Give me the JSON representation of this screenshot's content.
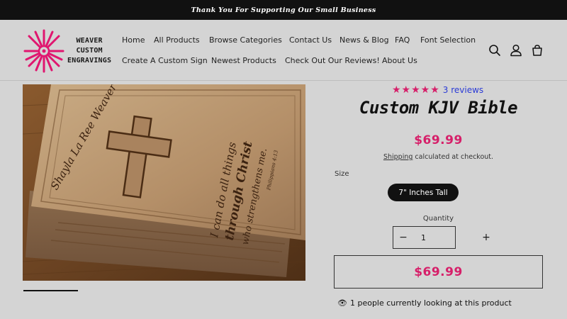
{
  "announcement": "Thank You For Supporting Our Small Business",
  "logo": {
    "line1": "WEAVER",
    "line2": "CUSTOM",
    "line3": "ENGRAVINGS",
    "brand_color": "#e0166f"
  },
  "nav": {
    "row1": [
      "Home",
      "All Products",
      "Browse Categories",
      "Contact Us",
      "News & Blog",
      "FAQ",
      "Font Selection"
    ],
    "row2": [
      "Create A Custom Sign",
      "Newest Products",
      "Check Out Our Reviews!",
      "About Us"
    ]
  },
  "header_icons": [
    "search-icon",
    "account-icon",
    "cart-icon"
  ],
  "product": {
    "rating_stars": "★★★★★",
    "rating": 4.7,
    "reviews_text": "3 reviews",
    "title": "Custom KJV Bible",
    "price": "$69.99",
    "shipping_link": "Shipping",
    "shipping_rest": " calculated at checkout.",
    "size_label": "Size",
    "size_option": "7\" Inches Tall",
    "quantity_label": "Quantity",
    "quantity_value": "1",
    "minus": "−",
    "plus": "+",
    "button_price": "$69.99",
    "viewers_text": "1 people currently looking at this product"
  },
  "image_text": {
    "name": "Shayla La Ree Weaver",
    "verse1": "I can do all things",
    "verse2": "through Christ",
    "verse3": "who strengthens me.",
    "ref": "Philippians 4:13"
  },
  "colors": {
    "accent": "#d61f69",
    "link": "#2b3bd6",
    "background": "#d4d4d4",
    "announcement_bg": "#111111"
  }
}
